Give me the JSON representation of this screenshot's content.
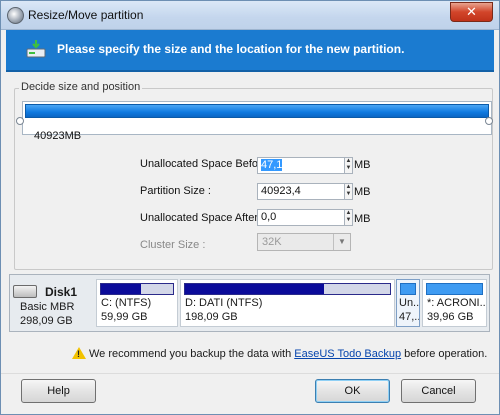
{
  "window": {
    "title": "Resize/Move partition",
    "close_label": "✕"
  },
  "banner": {
    "text": "Please specify the size and the location for the new partition."
  },
  "group": {
    "title": "Decide size and position",
    "slider_size_label": "40923MB"
  },
  "fields": {
    "unalloc_before": {
      "label": "Unallocated Space Before:",
      "value": "47,1",
      "unit": "MB"
    },
    "partition_size": {
      "label": "Partition Size :",
      "value": "40923,4",
      "unit": "MB"
    },
    "unalloc_after": {
      "label": "Unallocated Space After:",
      "value": "0,0",
      "unit": "MB"
    },
    "cluster_size": {
      "label": "Cluster Size :",
      "value": "32K"
    }
  },
  "disk": {
    "name": "Disk1",
    "type": "Basic MBR",
    "size": "298,09 GB",
    "partitions": [
      {
        "name": "C: (NTFS)",
        "size": "59,99 GB",
        "used_fraction": 0.55
      },
      {
        "name": "D: DATI (NTFS)",
        "size": "198,09 GB",
        "used_fraction": 0.68
      },
      {
        "name": "Un...",
        "size": "47,..."
      },
      {
        "name": "*: ACRONI...",
        "size": "39,96 GB"
      }
    ]
  },
  "notice": {
    "prefix": "We recommend you backup the data with ",
    "link": "EaseUS Todo Backup",
    "suffix": " before operation."
  },
  "buttons": {
    "help": "Help",
    "ok": "OK",
    "cancel": "Cancel"
  },
  "colors": {
    "banner": "#1b7bd0",
    "slider": "#0f79e0",
    "partition_used": "#0b0b9a"
  }
}
